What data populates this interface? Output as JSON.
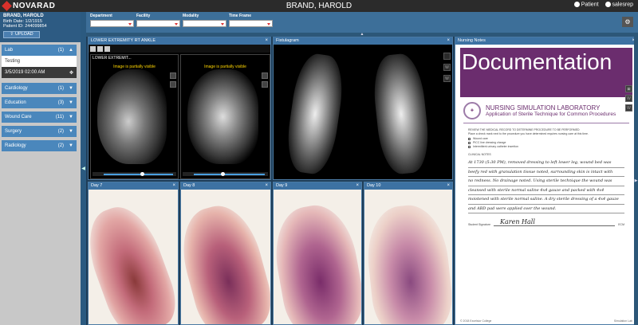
{
  "app": {
    "logo": "NOVARAD",
    "title": "BRAND, HAROLD",
    "patient_link": "Patient",
    "user": "salesrep"
  },
  "patient": {
    "name": "BRAND, HAROLD",
    "birth_date": "Birth Date: 1/2/1915",
    "patient_id": "Patient ID: 244099854",
    "upload_label": "UPLOAD"
  },
  "sidebar": {
    "categories": [
      {
        "label": "Lab",
        "count": "(1)"
      },
      {
        "label": "Cardiology",
        "count": "(1)"
      },
      {
        "label": "Education",
        "count": "(3)"
      },
      {
        "label": "Wound Care",
        "count": "(11)"
      },
      {
        "label": "Surgery",
        "count": "(2)"
      },
      {
        "label": "Radiology",
        "count": "(2)"
      }
    ],
    "lab_sub": "Testing",
    "date_item": "3/5/2019 02:00 AM"
  },
  "filters": {
    "department": "Department",
    "facility": "Facility",
    "modality": "Modality",
    "timeframe": "Time Frame"
  },
  "panels": {
    "mri_title": "LOWER EXTREMITY RT ANKLE",
    "mri_left_label": "LOWER EXTREMIT...",
    "mri_warning": "Image is partially visible",
    "fistulagram_title": "Fistulagram",
    "notes_title": "Nursing Notes",
    "day7": "Day 7",
    "day8": "Day 8",
    "day9": "Day 9",
    "day10": "Day 10"
  },
  "document": {
    "banner": "Documentation",
    "title": "NURSING SIMULATION LABORATORY",
    "subtitle": "Application of Sterile Technique for Common Procedures",
    "instruction1": "REVIEW THE MEDICAL RECORD TO DETERMINE PROCEDURE TO BE PERFORMED",
    "instruction2": "Place a check mark next to the procedure you have determined requires nursing care at this time.",
    "check1": "Wound care",
    "check2": "PICC line dressing change",
    "check3": "Intermittent urinary catheter insertion",
    "notes_label": "CLINICAL NOTES",
    "note_lines": [
      "At 1730 (5:30 PM), removed dressing to left lower leg, wound bed was",
      "beefy red with granulation tissue noted, surrounding skin is intact with",
      "no redness. No drainage noted. Using sterile technique the wound was",
      "cleansed with sterile normal saline 4x4 gauze and packed with 4x4",
      "moistened with sterile normal saline. A dry sterile dressing of a 4x4 gauze",
      "and ABD pad were applied over the wound."
    ],
    "signature_label": "Student Signature",
    "signature": "Karen Hall",
    "signature_suffix": "ECM",
    "footer_left": "© 2018 Excelsior College",
    "footer_right": "Simulation Lab"
  },
  "colors": {
    "accent": "#3d72a3",
    "banner": "#6b2d6e",
    "topbar": "#2b2b2b"
  }
}
